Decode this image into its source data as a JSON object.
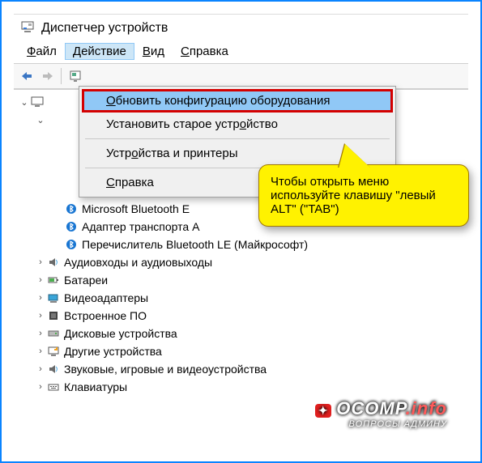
{
  "window": {
    "title": "Диспетчер устройств"
  },
  "menu": {
    "file": {
      "pre": "",
      "hot": "Ф",
      "post": "айл"
    },
    "action": {
      "pre": "",
      "hot": "Д",
      "post": "ействие"
    },
    "view": {
      "pre": "",
      "hot": "В",
      "post": "ид"
    },
    "help": {
      "pre": "",
      "hot": "С",
      "post": "правка"
    }
  },
  "dropdown": {
    "scan": {
      "pre": "",
      "hot": "О",
      "post": "бновить конфигурацию оборудования"
    },
    "legacy": {
      "pre": "Установить старое устр",
      "hot": "о",
      "post": "йство"
    },
    "printers": {
      "pre": "Устр",
      "hot": "о",
      "post": "йства и принтеры"
    },
    "help": {
      "pre": "",
      "hot": "С",
      "post": "правка"
    }
  },
  "callout": {
    "text": "Чтобы открыть меню используйте клавишу \"левый ALT\" (\"TAB\")"
  },
  "tree": {
    "bt1": "Microsoft Bluetooth E",
    "bt2": "Адаптер транспорта A",
    "bt3": "Перечислитель Bluetooth LE (Майкрософт)",
    "audio": "Аудиовходы и аудиовыходы",
    "battery": "Батареи",
    "video": "Видеоадаптеры",
    "embedded": "Встроенное ПО",
    "disk": "Дисковые устройства",
    "other": "Другие устройства",
    "sound": "Звуковые, игровые и видеоустройства",
    "keyboard": "Клавиатуры"
  },
  "watermark": {
    "main_a": "OCOMP",
    "main_b": ".info",
    "sub": "ВОПРОСЫ АДМИНУ"
  }
}
